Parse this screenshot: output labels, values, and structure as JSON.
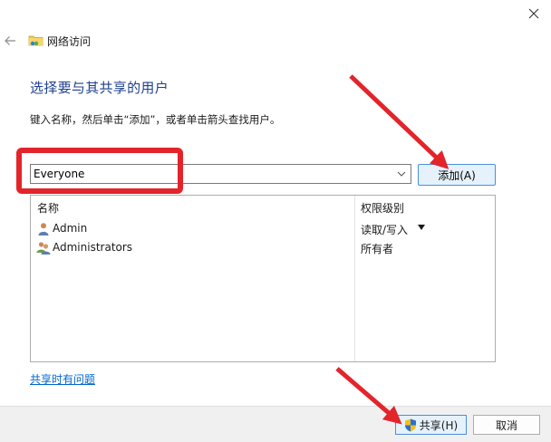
{
  "window": {
    "title": "网络访问"
  },
  "icons": {
    "close": "close-icon",
    "back": "back-arrow-icon",
    "folder": "shared-folder-icon",
    "dropdown": "chevron-down-icon",
    "user": "user-icon",
    "group": "group-icon",
    "shield": "uac-shield-icon"
  },
  "main": {
    "heading": "选择要与其共享的用户",
    "instruction": "键入名称，然后单击“添加”，或者单击箭头查找用户。",
    "combo_value": "Everyone",
    "add_button": "添加(A)"
  },
  "list": {
    "columns": [
      "名称",
      "权限级别"
    ],
    "rows": [
      {
        "name": "Admin",
        "permission": "读取/写入",
        "icon": "user-icon",
        "has_dropdown": true
      },
      {
        "name": "Administrators",
        "permission": "所有者",
        "icon": "group-icon",
        "has_dropdown": false
      }
    ]
  },
  "help_link": "共享时有问题",
  "footer": {
    "share_button": "共享(H)",
    "cancel_button": "取消"
  },
  "colors": {
    "heading": "#1f3f8f",
    "link": "#0066cc",
    "annotation": "#e3242b",
    "button_accent": "#4a90d9"
  }
}
